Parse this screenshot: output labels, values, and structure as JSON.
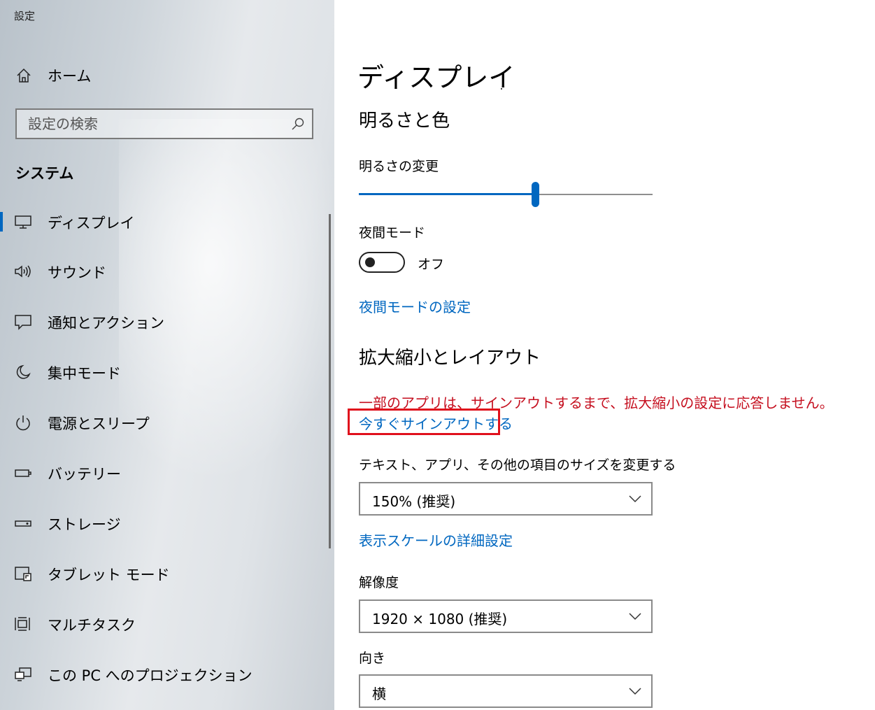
{
  "window": {
    "title": "設定"
  },
  "sidebar": {
    "home_label": "ホーム",
    "search_placeholder": "設定の検索",
    "section_title": "システム",
    "items": [
      {
        "label": "ディスプレイ",
        "icon": "monitor-icon",
        "selected": true
      },
      {
        "label": "サウンド",
        "icon": "speaker-icon"
      },
      {
        "label": "通知とアクション",
        "icon": "notification-icon"
      },
      {
        "label": "集中モード",
        "icon": "moon-icon"
      },
      {
        "label": "電源とスリープ",
        "icon": "power-icon"
      },
      {
        "label": "バッテリー",
        "icon": "battery-icon"
      },
      {
        "label": "ストレージ",
        "icon": "storage-icon"
      },
      {
        "label": "タブレット モード",
        "icon": "tablet-icon"
      },
      {
        "label": "マルチタスク",
        "icon": "multitask-icon"
      },
      {
        "label": "この PC へのプロジェクション",
        "icon": "projection-icon"
      }
    ]
  },
  "main": {
    "title": "ディスプレイ",
    "brightness_section": {
      "heading": "明るさと色",
      "brightness_label": "明るさの変更",
      "brightness_value": 0.6,
      "night_mode_label": "夜間モード",
      "night_mode_state": "オフ",
      "night_mode_link": "夜間モードの設定"
    },
    "layout_section": {
      "heading": "拡大縮小とレイアウト",
      "warning": "一部のアプリは、サインアウトするまで、拡大縮小の設定に応答しません。",
      "signout_link": "今すぐサインアウトする",
      "scale_label": "テキスト、アプリ、その他の項目のサイズを変更する",
      "scale_value": "150% (推奨)",
      "advanced_scale_link": "表示スケールの詳細設定",
      "resolution_label": "解像度",
      "resolution_value": "1920 × 1080 (推奨)",
      "orientation_label": "向き",
      "orientation_value": "横"
    }
  },
  "colors": {
    "accent": "#0067c0",
    "warning": "#c50f1f",
    "highlight_box": "#e0101c"
  }
}
